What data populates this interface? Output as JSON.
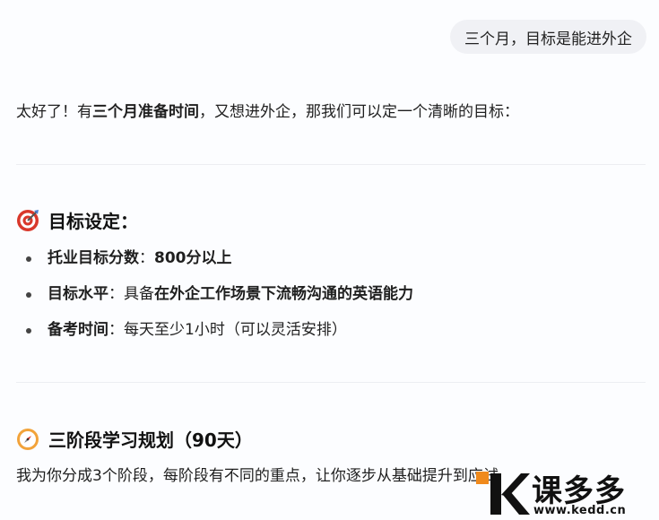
{
  "user_message": "三个月，目标是能进外企",
  "intro": {
    "part1": "太好了！有",
    "bold1": "三个月准备时间",
    "part2": "，又想进外企，那我们可以定一个清晰的目标："
  },
  "section_goals": {
    "icon": "target-icon",
    "title": "目标设定：",
    "items": [
      {
        "label": "托业目标分数",
        "sep": "：",
        "bold": "800分以上",
        "rest": ""
      },
      {
        "label": "目标水平",
        "sep": "：具备",
        "bold": "在外企工作场景下流畅沟通的英语能力",
        "rest": ""
      },
      {
        "label": "备考时间",
        "sep": "：",
        "bold": "",
        "rest": "每天至少1小时（可以灵活安排）"
      }
    ]
  },
  "section_plan": {
    "icon": "compass-icon",
    "title": "三阶段学习规划（90天）",
    "text": "我为你分成3个阶段，每阶段有不同的重点，让你逐步从基础提升到应试"
  },
  "watermark": {
    "brand": "课多多",
    "url": "www.kedd.cn",
    "accent": "#f08a1c"
  },
  "colors": {
    "bubble_bg": "#f0f1f5",
    "page_bg": "#fcfdff",
    "target_red": "#d9382b"
  }
}
